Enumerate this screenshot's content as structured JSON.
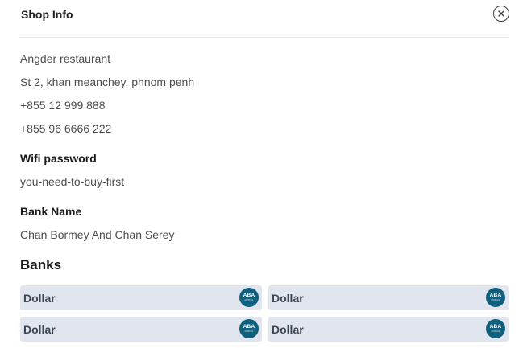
{
  "header": {
    "title": "Shop Info",
    "close_icon": "close-icon"
  },
  "shop": {
    "name": "Angder restaurant",
    "address": "St 2, khan meanchey, phnom penh",
    "phone1": "+855 12 999 888",
    "phone2": "+855 96 6666 222"
  },
  "wifi": {
    "label": "Wifi password",
    "value": "you-need-to-buy-first"
  },
  "bank_name": {
    "label": "Bank Name",
    "value": "Chan Bormey And Chan Serey"
  },
  "banks": {
    "title": "Banks",
    "items": [
      {
        "currency": "Dollar",
        "logo_abbr": "ABA",
        "logo_sub": "MOBILE"
      },
      {
        "currency": "Dollar",
        "logo_abbr": "ABA",
        "logo_sub": "MOBILE"
      },
      {
        "currency": "Dollar",
        "logo_abbr": "ABA",
        "logo_sub": "MOBILE"
      },
      {
        "currency": "Dollar",
        "logo_abbr": "ABA",
        "logo_sub": "MOBILE"
      }
    ]
  },
  "colors": {
    "card_bg": "#e1e6ee",
    "logo_bg": "#0f5f7d",
    "text_muted": "#4d4d4d"
  }
}
